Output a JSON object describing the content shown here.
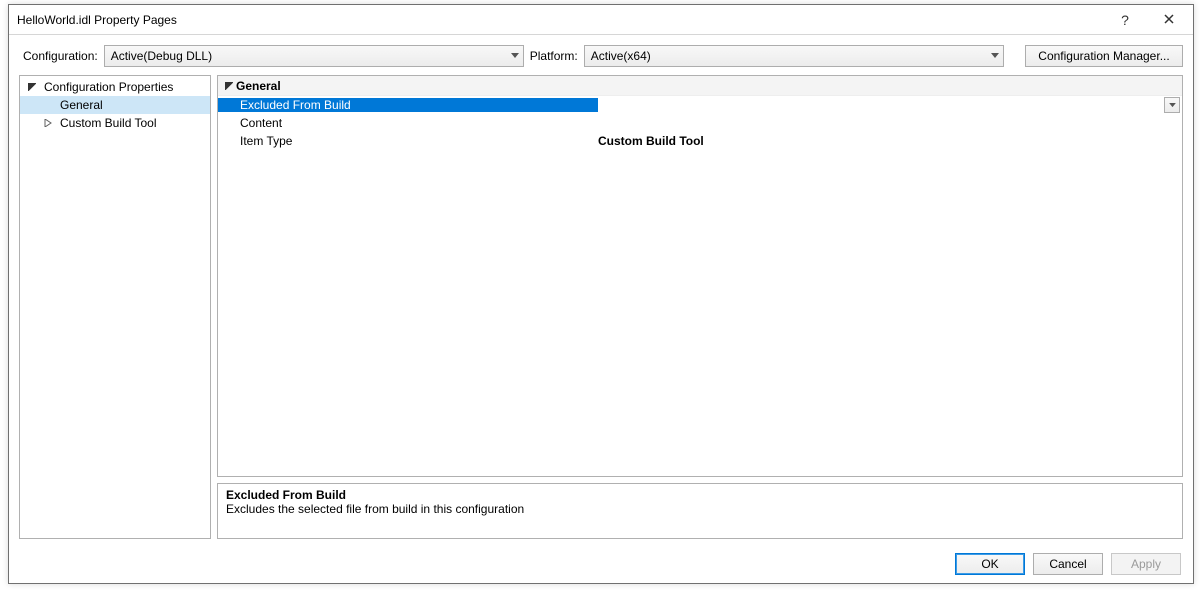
{
  "window": {
    "title": "HelloWorld.idl Property Pages"
  },
  "titlebar": {
    "help_tooltip": "?",
    "close_tooltip": "Close"
  },
  "toprow": {
    "configuration_label": "Configuration:",
    "configuration_value": "Active(Debug DLL)",
    "platform_label": "Platform:",
    "platform_value": "Active(x64)",
    "config_manager_label": "Configuration Manager..."
  },
  "tree": {
    "root": "Configuration Properties",
    "items": [
      {
        "label": "General",
        "selected": true,
        "hasChildren": false
      },
      {
        "label": "Custom Build Tool",
        "selected": false,
        "hasChildren": true
      }
    ]
  },
  "propgrid": {
    "category": "General",
    "rows": [
      {
        "name": "Excluded From Build",
        "value": "",
        "selected": true,
        "hasDropdown": true
      },
      {
        "name": "Content",
        "value": "",
        "selected": false,
        "hasDropdown": false
      },
      {
        "name": "Item Type",
        "value": "Custom Build Tool",
        "selected": false,
        "hasDropdown": false
      }
    ]
  },
  "help": {
    "title": "Excluded From Build",
    "desc": "Excludes the selected file from build in this configuration"
  },
  "footer": {
    "ok": "OK",
    "cancel": "Cancel",
    "apply": "Apply"
  }
}
